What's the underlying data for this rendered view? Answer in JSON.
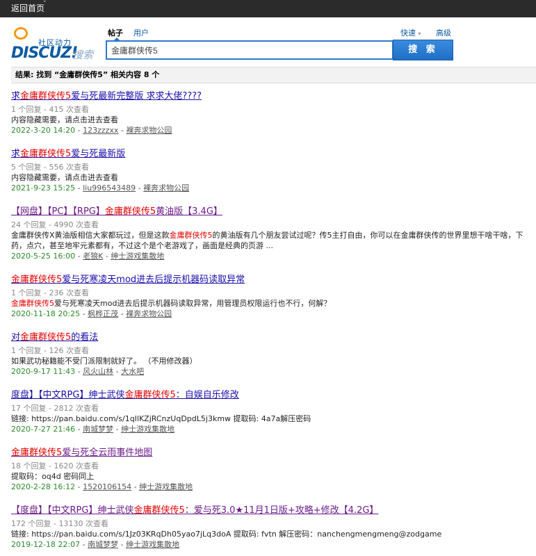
{
  "topbar": {
    "home_label": "返回首页",
    "caret": "˅"
  },
  "header": {
    "logo": {
      "tagline": "社区动力",
      "wordmark": "DISCUZ!",
      "suffix": "搜索"
    },
    "search_types": {
      "active": "帖子",
      "other": "用户"
    },
    "quick_label": "快速",
    "quick_arrow": "▾",
    "advanced_label": "高级",
    "search_value": "金庸群侠传5",
    "search_button": "搜 索"
  },
  "result_summary": "结果: 找到 “金庸群侠传5” 相关内容 8 个",
  "results": [
    {
      "title_pre": "求",
      "title_hl": "金庸群侠传5",
      "title_post": "爱与死最新完整版 求求大佬????",
      "visited": false,
      "stats": "1 个回复 - 415 次查看",
      "snippet_pre": "内容隐藏需要，请点击进去查看",
      "snippet_hl": "",
      "snippet_post": "",
      "date": "2022-3-20 14:20",
      "author": "123zzzxx",
      "forum": "裸奔求物公园"
    },
    {
      "title_pre": "求",
      "title_hl": "金庸群侠传5",
      "title_post": "爱与死最新版",
      "visited": false,
      "stats": "5 个回复 - 556 次查看",
      "snippet_pre": "内容隐藏需要，请点击进去查看",
      "snippet_hl": "",
      "snippet_post": "",
      "date": "2021-9-23 15:25",
      "author": "liu996543489",
      "forum": "裸奔求物公园"
    },
    {
      "title_pre": "【网盘】【PC】【RPG】",
      "title_hl": "金庸群侠传5",
      "title_post": "黄油版【3.4G】",
      "visited": true,
      "stats": "24 个回复 - 4990 次查看",
      "snippet_pre": "金庸群侠传X黄油版相信大家都玩过，但是这款",
      "snippet_hl": "金庸群侠传5",
      "snippet_post": "的黄油版有几个朋友尝试过呢？传5主打自由，你可以在金庸群侠传的世界里想干啥干啥，下药，点穴，甚至地牢元素都有，不过这个是个老游戏了，画面是经典的页游 ...",
      "date": "2020-5-25 16:00",
      "author": "老狼K",
      "forum": "绅士游戏集散地"
    },
    {
      "title_pre": "",
      "title_hl": "金庸群侠传5",
      "title_post": "爱与死寒凌天mod进去后提示机器码读取异常",
      "visited": false,
      "stats": "1 个回复 - 236 次查看",
      "snippet_pre": "",
      "snippet_hl": "金庸群侠传5",
      "snippet_post": "爱与死寒凌天mod进去后提示机器码读取异常，用管理员权限运行也不行，何解？",
      "date": "2020-11-18 20:25",
      "author": "枫桦正茂",
      "forum": "裸奔求物公园"
    },
    {
      "title_pre": "对",
      "title_hl": "金庸群侠传5",
      "title_post": "的看法",
      "visited": false,
      "stats": "1 个回复 - 126 次查看",
      "snippet_pre": "如果武功秘籍能不受门派限制就好了。 （不用修改器）",
      "snippet_hl": "",
      "snippet_post": "",
      "date": "2020-9-17 11:43",
      "author": "风火山林",
      "forum": "大水吧"
    },
    {
      "title_pre": "度盘】【中文RPG】绅士武侠",
      "title_hl": "金庸群侠传5",
      "title_post": "：自娱自乐修改",
      "visited": false,
      "stats": "17 个回复 - 2812 次查看",
      "snippet_pre": "链接: https://pan.baidu.com/s/1qIlKZjRCnzUqDpdL5j3kmw 提取码: 4a7a解压密码",
      "snippet_hl": "",
      "snippet_post": "",
      "date": "2020-7-27 21:46",
      "author": "南城梦梦",
      "forum": "绅士游戏集散地"
    },
    {
      "title_pre": "",
      "title_hl": "金庸群侠传5",
      "title_post": "爱与死全云雨事件地图",
      "visited": true,
      "stats": "18 个回复 - 1620 次查看",
      "snippet_pre": "提取码：oq4d 密码同上",
      "snippet_hl": "",
      "snippet_post": "",
      "date": "2020-2-28 16:12",
      "author": "1520106154",
      "forum": "绅士游戏集散地"
    },
    {
      "title_pre": "【度盘】【中文RPG】绅士武侠",
      "title_hl": "金庸群侠传5",
      "title_post": "：爱与死3.0★11月1日版+攻略+修改【4.2G】",
      "visited": true,
      "stats": "172 个回复 - 13130 次查看",
      "snippet_pre": "链接: https://pan.baidu.com/s/1Jz03KRqDh05yao7jLq3doA 提取码: fvtn 解压密码：nanchengmengmeng@zodgame",
      "snippet_hl": "",
      "snippet_post": "",
      "date": "2019-12-18 22:07",
      "author": "南城梦梦",
      "forum": "绅士游戏集散地"
    }
  ]
}
